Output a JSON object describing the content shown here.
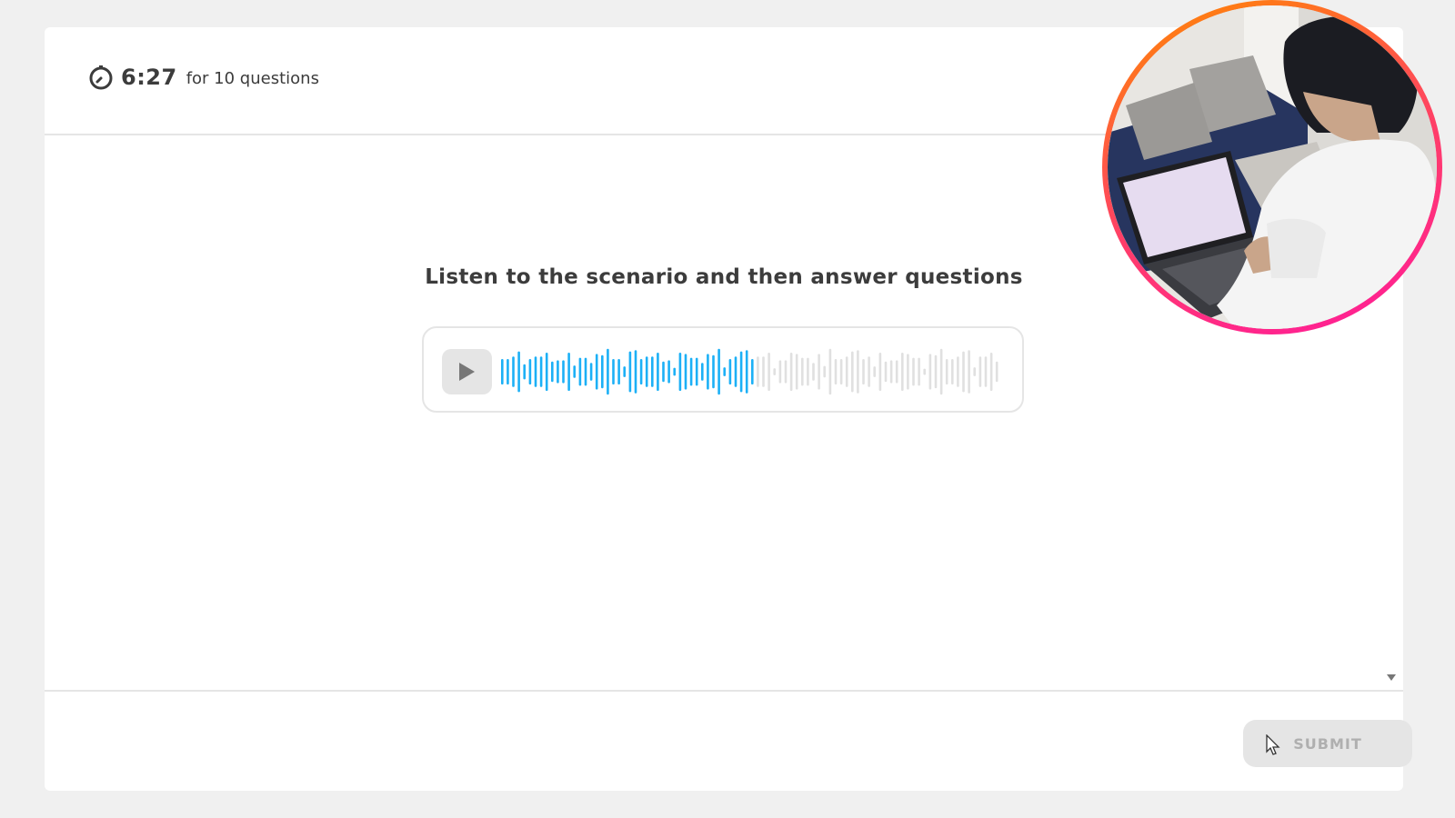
{
  "timer": {
    "value": "6:27",
    "suffix": "for 10 questions",
    "icon": "stopwatch-icon"
  },
  "prompt": {
    "text": "Listen to the scenario and then answer questions"
  },
  "audio": {
    "play_icon": "play-icon",
    "progress_fraction": 0.51,
    "played_color": "#1cb0f6",
    "unplayed_color": "#e0e0e0"
  },
  "footer": {
    "submit_label": "SUBMIT",
    "submit_enabled": false
  },
  "colors": {
    "background": "#f0f0f0",
    "card": "#ffffff",
    "text": "#3c3c3c",
    "webcam_ring": "#ff3d6a"
  }
}
